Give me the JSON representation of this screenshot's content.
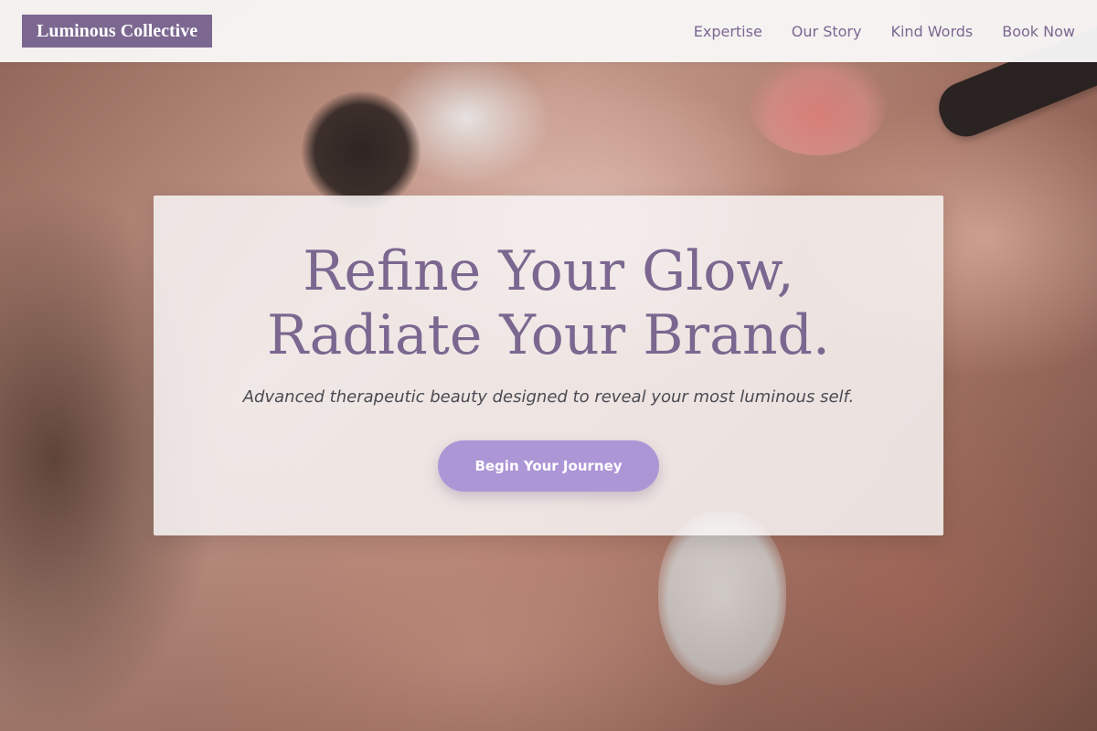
{
  "header": {
    "logo_text": "Luminous Collective",
    "nav": [
      {
        "label": "Expertise"
      },
      {
        "label": "Our Story"
      },
      {
        "label": "Kind Words"
      },
      {
        "label": "Book Now"
      }
    ]
  },
  "hero": {
    "title_line_1": "Refine Your Glow,",
    "title_line_2": "Radiate Your Brand.",
    "subtitle": "Advanced therapeutic beauty designed to reveal your most luminous self.",
    "cta_label": "Begin Your Journey",
    "background_image": "blurred close-up of a beauty treatment"
  },
  "colors": {
    "brand_purple": "#7b6790",
    "cta_lavender": "#ad96d6",
    "header_bg": "#f8f7f7"
  }
}
